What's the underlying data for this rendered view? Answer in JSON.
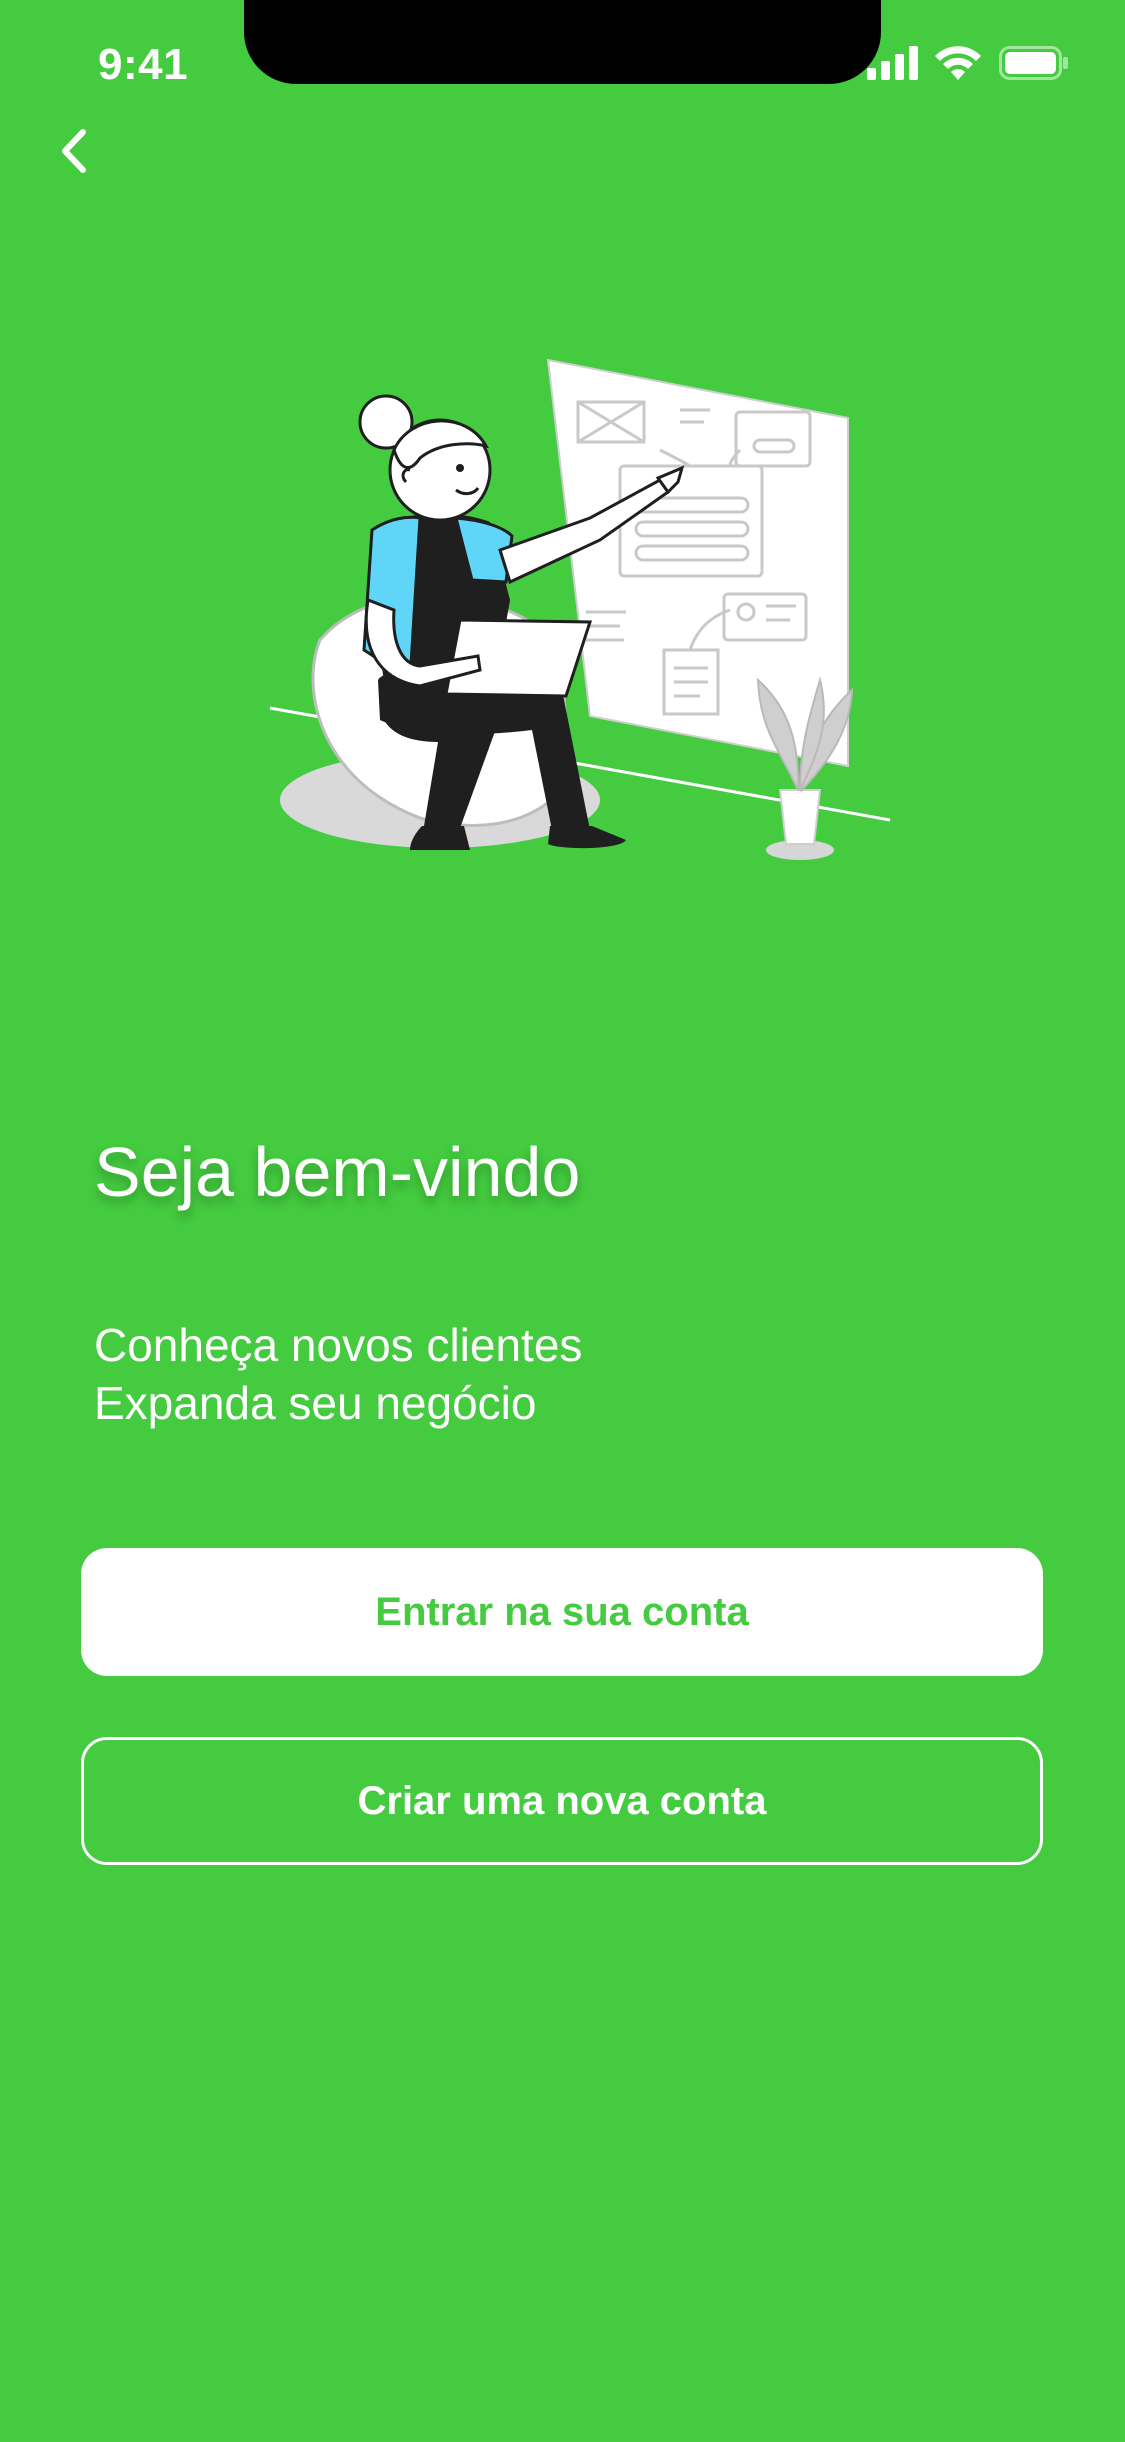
{
  "status_bar": {
    "time": "9:41",
    "icons": [
      "cellular-signal-icon",
      "wifi-icon",
      "battery-icon"
    ]
  },
  "nav": {
    "back_icon": "chevron-left-icon"
  },
  "illustration": {
    "description_icon": "woman-presenting-board-illustration"
  },
  "welcome": {
    "title": "Seja bem-vindo",
    "line1": "Conheça novos clientes",
    "line2": "Expanda seu negócio"
  },
  "actions": {
    "login_label": "Entrar na sua conta",
    "signup_label": "Criar uma nova conta"
  },
  "colors": {
    "background": "#44cb3f",
    "button_text": "#44cb3f",
    "white": "#ffffff"
  }
}
